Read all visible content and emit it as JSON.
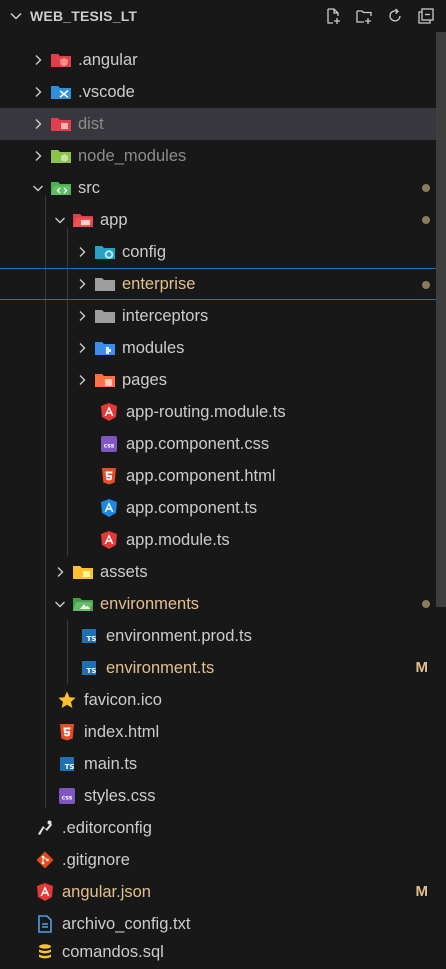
{
  "explorer": {
    "title": "WEB_TESIS_LT",
    "actions": [
      "new-file-icon",
      "new-folder-icon",
      "refresh-icon",
      "collapse-all-icon"
    ]
  },
  "tree": [
    {
      "label": ".angular",
      "icon": "folder-angular-icon",
      "color": "#e0404e"
    },
    {
      "label": ".vscode",
      "icon": "folder-vscode-icon",
      "color": "#2f8fdd"
    },
    {
      "label": "dist",
      "icon": "folder-dist-icon",
      "color": "#e0404e"
    },
    {
      "label": "node_modules",
      "icon": "folder-node-icon",
      "color": "#8bc34a"
    },
    {
      "label": "src",
      "icon": "folder-src-icon",
      "color": "#4caf50"
    },
    {
      "label": "app",
      "icon": "folder-app-icon",
      "color": "#e0404e"
    },
    {
      "label": "config",
      "icon": "folder-config-icon",
      "color": "#26a3c4"
    },
    {
      "label": "enterprise",
      "icon": "folder-icon",
      "color": "#9e9e9e"
    },
    {
      "label": "interceptors",
      "icon": "folder-icon",
      "color": "#9e9e9e"
    },
    {
      "label": "modules",
      "icon": "folder-modules-icon",
      "color": "#3b8eea"
    },
    {
      "label": "pages",
      "icon": "folder-pages-icon",
      "color": "#ff7043"
    },
    {
      "label": "app-routing.module.ts",
      "icon": "angular-routing-icon",
      "color": "#e53935"
    },
    {
      "label": "app.component.css",
      "icon": "css-icon",
      "color": "#7e57c2"
    },
    {
      "label": "app.component.html",
      "icon": "html-icon",
      "color": "#e44d26"
    },
    {
      "label": "app.component.ts",
      "icon": "angular-component-icon",
      "color": "#1e88e5"
    },
    {
      "label": "app.module.ts",
      "icon": "angular-module-icon",
      "color": "#e53935"
    },
    {
      "label": "assets",
      "icon": "folder-assets-icon",
      "color": "#fbc02d"
    },
    {
      "label": "environments",
      "icon": "folder-environment-icon",
      "color": "#66bb6a"
    },
    {
      "label": "environment.prod.ts",
      "icon": "typescript-icon",
      "color": "#1f6fb5"
    },
    {
      "label": "environment.ts",
      "icon": "typescript-icon",
      "color": "#1f6fb5",
      "badge": "M"
    },
    {
      "label": "favicon.ico",
      "icon": "star-icon",
      "color": "#fbc02d"
    },
    {
      "label": "index.html",
      "icon": "html-icon",
      "color": "#e44d26"
    },
    {
      "label": "main.ts",
      "icon": "typescript-icon",
      "color": "#1f6fb5"
    },
    {
      "label": "styles.css",
      "icon": "css-icon",
      "color": "#7e57c2"
    },
    {
      "label": ".editorconfig",
      "icon": "editorconfig-icon",
      "color": "#e0e0e0"
    },
    {
      "label": ".gitignore",
      "icon": "git-icon",
      "color": "#e64a19"
    },
    {
      "label": "angular.json",
      "icon": "angular-icon",
      "color": "#e53935",
      "badge": "M"
    },
    {
      "label": "archivo_config.txt",
      "icon": "text-file-icon",
      "color": "#4f9fe6"
    },
    {
      "label": "comandos.sql",
      "icon": "database-icon",
      "color": "#fbc02d"
    }
  ]
}
